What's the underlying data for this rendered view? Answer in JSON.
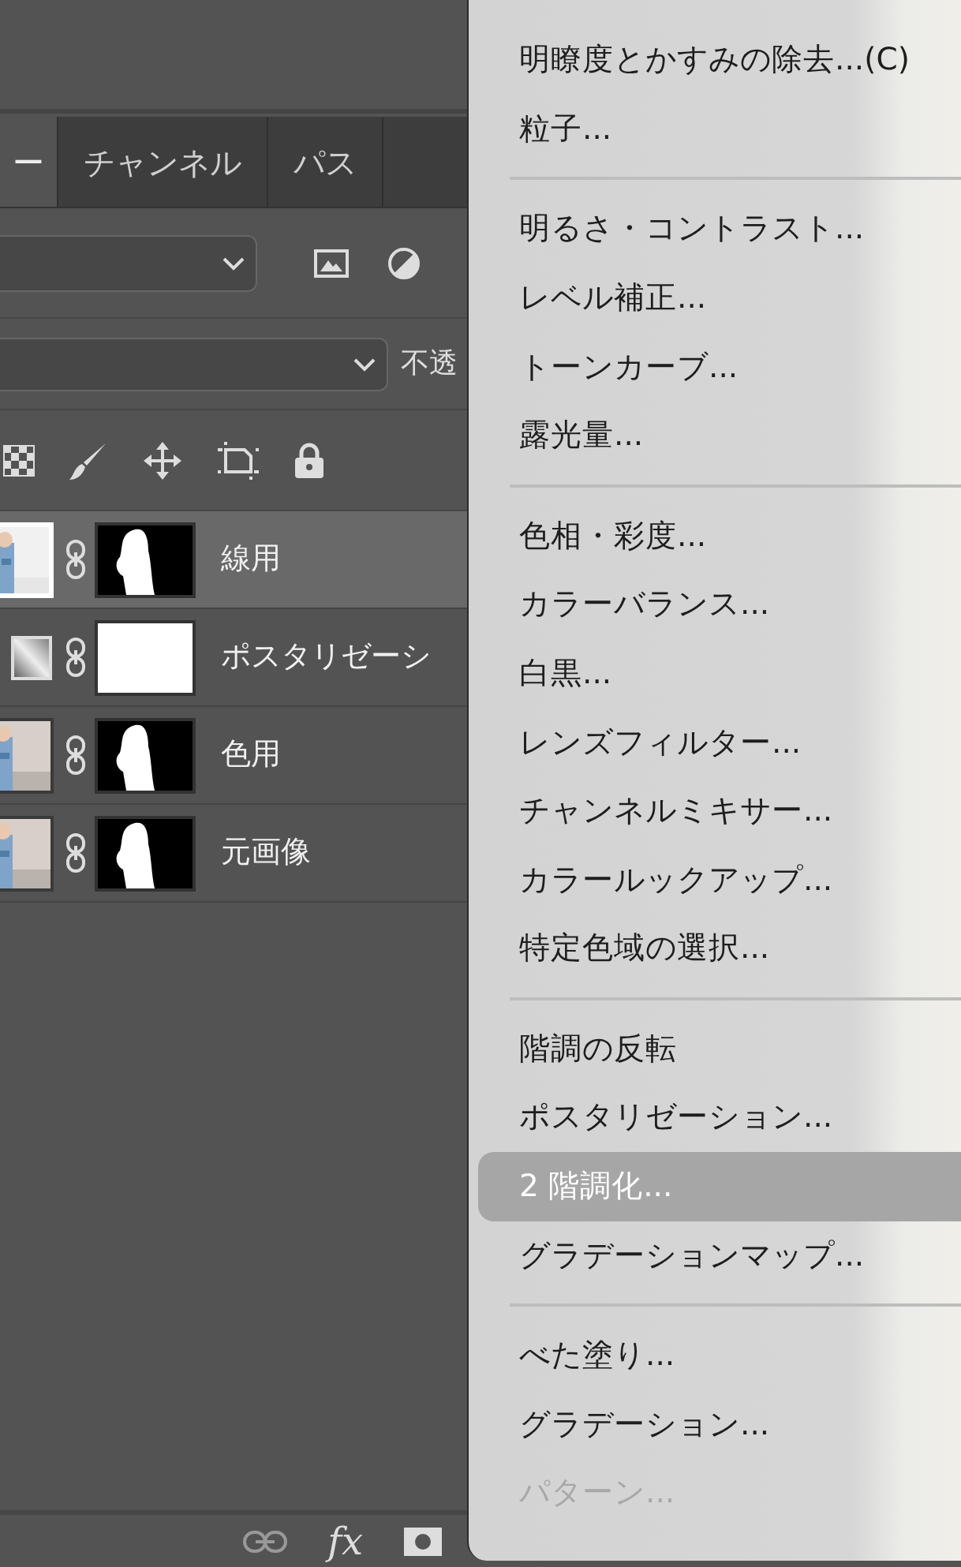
{
  "tabs": [
    {
      "label": "ー",
      "selected": true
    },
    {
      "label": "チャンネル",
      "selected": false
    },
    {
      "label": "パス",
      "selected": false
    }
  ],
  "opacity_label": "不透",
  "layers": [
    {
      "name": "線用",
      "selected": true,
      "mask": {
        "kind": "silhouette"
      }
    },
    {
      "name": "ポスタリゼーシ",
      "selected": false,
      "thumbnail": {
        "kind": "adjustment"
      },
      "mask": {
        "kind": "white"
      }
    },
    {
      "name": "色用",
      "selected": false,
      "mask": {
        "kind": "silhouette"
      }
    },
    {
      "name": "元画像",
      "selected": false,
      "mask": {
        "kind": "silhouette"
      }
    }
  ],
  "bottom_bar": {
    "fx_label": "fx"
  },
  "menu": {
    "items": [
      {
        "kind": "item",
        "label": "明瞭度とかすみの除去...(C)",
        "selected": false,
        "disabled": false
      },
      {
        "kind": "item",
        "label": "粒子...",
        "selected": false,
        "disabled": false
      },
      {
        "kind": "separator"
      },
      {
        "kind": "item",
        "label": "明るさ・コントラスト...",
        "selected": false,
        "disabled": false
      },
      {
        "kind": "item",
        "label": "レベル補正...",
        "selected": false,
        "disabled": false
      },
      {
        "kind": "item",
        "label": "トーンカーブ...",
        "selected": false,
        "disabled": false
      },
      {
        "kind": "item",
        "label": "露光量...",
        "selected": false,
        "disabled": false
      },
      {
        "kind": "separator"
      },
      {
        "kind": "item",
        "label": "色相・彩度...",
        "selected": false,
        "disabled": false
      },
      {
        "kind": "item",
        "label": "カラーバランス...",
        "selected": false,
        "disabled": false
      },
      {
        "kind": "item",
        "label": "白黒...",
        "selected": false,
        "disabled": false
      },
      {
        "kind": "item",
        "label": "レンズフィルター...",
        "selected": false,
        "disabled": false
      },
      {
        "kind": "item",
        "label": "チャンネルミキサー...",
        "selected": false,
        "disabled": false
      },
      {
        "kind": "item",
        "label": "カラールックアップ...",
        "selected": false,
        "disabled": false
      },
      {
        "kind": "item",
        "label": "特定色域の選択...",
        "selected": false,
        "disabled": false
      },
      {
        "kind": "separator"
      },
      {
        "kind": "item",
        "label": "階調の反転",
        "selected": false,
        "disabled": false
      },
      {
        "kind": "item",
        "label": "ポスタリゼーション...",
        "selected": false,
        "disabled": false
      },
      {
        "kind": "item",
        "label": "2 階調化...",
        "selected": true,
        "disabled": false
      },
      {
        "kind": "item",
        "label": "グラデーションマップ...",
        "selected": false,
        "disabled": false
      },
      {
        "kind": "separator"
      },
      {
        "kind": "item",
        "label": "べた塗り...",
        "selected": false,
        "disabled": false
      },
      {
        "kind": "item",
        "label": "グラデーション...",
        "selected": false,
        "disabled": false
      },
      {
        "kind": "item",
        "label": "パターン...",
        "selected": false,
        "disabled": true
      }
    ]
  }
}
